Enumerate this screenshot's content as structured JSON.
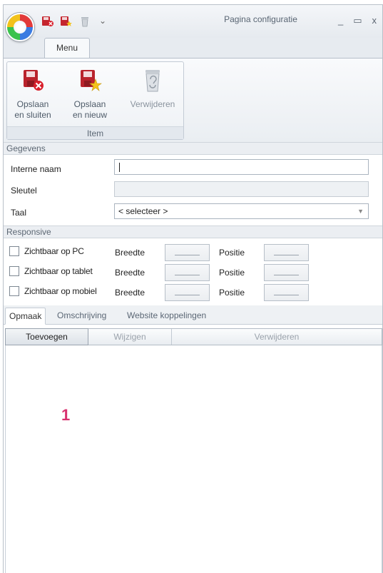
{
  "window": {
    "title": "Pagina configuratie",
    "controls": [
      "_",
      "▭",
      "x"
    ]
  },
  "ribbon": {
    "tab_label": "Menu",
    "group_label": "Item",
    "buttons": [
      {
        "label_line1": "Opslaan",
        "label_line2": "en sluiten",
        "icon": "save-close-icon"
      },
      {
        "label_line1": "Opslaan",
        "label_line2": "en nieuw",
        "icon": "save-new-icon"
      },
      {
        "label_line1": "Verwijderen",
        "label_line2": "",
        "icon": "recycle-bin-icon"
      }
    ]
  },
  "gegevens": {
    "header": "Gegevens",
    "interne_naam_label": "Interne naam",
    "interne_naam_value": "",
    "sleutel_label": "Sleutel",
    "sleutel_value": "",
    "taal_label": "Taal",
    "taal_value": "< selecteer >"
  },
  "responsive": {
    "header": "Responsive",
    "breedte_label": "Breedte",
    "positie_label": "Positie",
    "rows": [
      {
        "label": "Zichtbaar op PC"
      },
      {
        "label": "Zichtbaar op tablet"
      },
      {
        "label": "Zichtbaar op mobiel"
      }
    ]
  },
  "tabs": [
    {
      "label": "Opmaak",
      "active": true
    },
    {
      "label": "Omschrijving",
      "active": false
    },
    {
      "label": "Website koppelingen",
      "active": false
    }
  ],
  "toolbar": {
    "add_label": "Toevoegen",
    "edit_label": "Wijzigen",
    "delete_label": "Verwijderen"
  },
  "annotation": {
    "marker": "1"
  },
  "colors": {
    "marker": "#d8316f",
    "accent_red": "#c4252e"
  }
}
